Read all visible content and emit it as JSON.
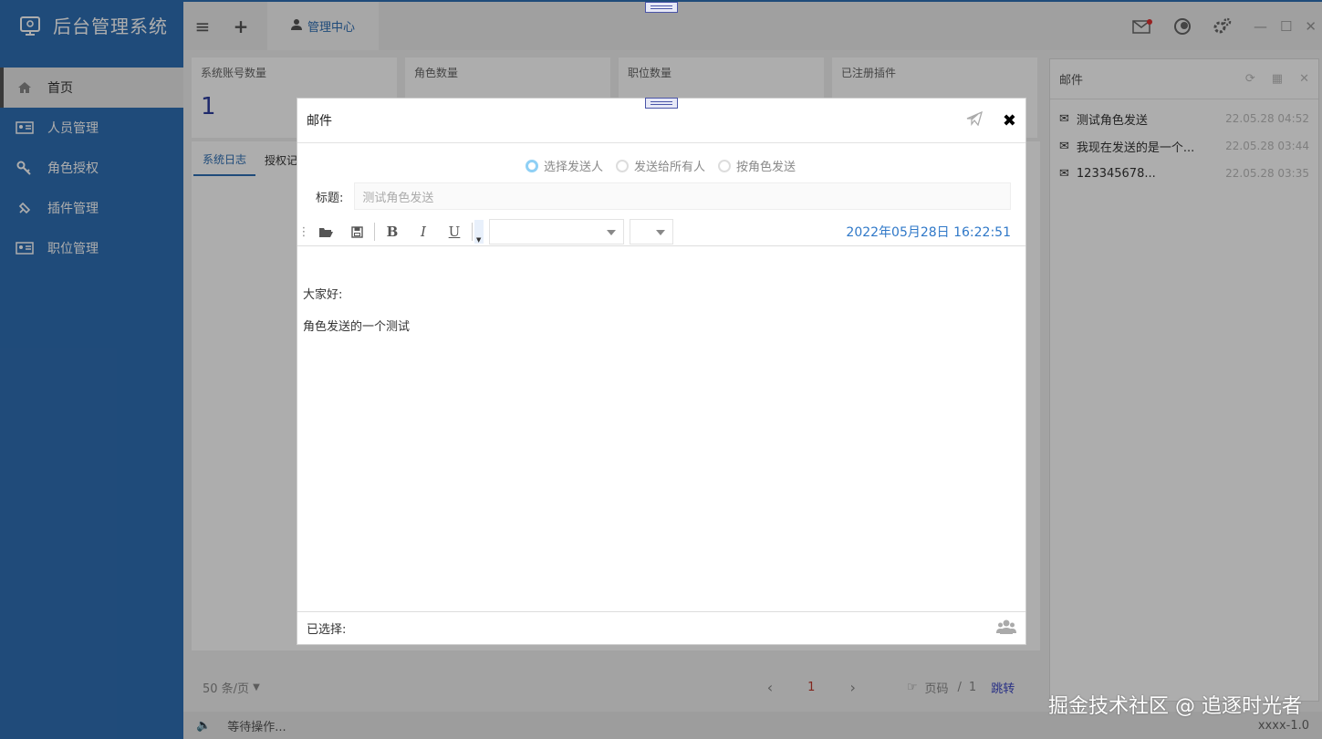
{
  "app": {
    "title": "后台管理系统",
    "version": "xxxx-1.0",
    "status": "等待操作..."
  },
  "sidebar": {
    "items": [
      {
        "label": "首页",
        "icon": "home-icon",
        "active": true
      },
      {
        "label": "人员管理",
        "icon": "id-card-icon"
      },
      {
        "label": "角色授权",
        "icon": "key-icon"
      },
      {
        "label": "插件管理",
        "icon": "plug-icon"
      },
      {
        "label": "职位管理",
        "icon": "id-card-icon"
      }
    ]
  },
  "topbar": {
    "tab_label": "管理中心"
  },
  "stats": [
    {
      "label": "系统账号数量",
      "value": "1"
    },
    {
      "label": "角色数量",
      "value": ""
    },
    {
      "label": "职位数量",
      "value": ""
    },
    {
      "label": "已注册插件",
      "value": ""
    }
  ],
  "subtabs": [
    "系统日志",
    "授权记"
  ],
  "pager": {
    "per_page": "50 条/页",
    "current": "1",
    "page_label": "页码",
    "total": "1",
    "jump": "跳转"
  },
  "mailpanel": {
    "title": "邮件",
    "items": [
      {
        "subject": "测试角色发送",
        "time": "22.05.28 04:52",
        "icon": "envelope-open-icon"
      },
      {
        "subject": "我现在发送的是一个...",
        "time": "22.05.28 03:44",
        "icon": "envelope-icon"
      },
      {
        "subject": "123345678...",
        "time": "22.05.28 03:35",
        "icon": "envelope-open-icon"
      }
    ]
  },
  "dialog": {
    "title": "邮件",
    "radios": [
      {
        "label": "选择发送人",
        "checked": true
      },
      {
        "label": "发送给所有人",
        "checked": false
      },
      {
        "label": "按角色发送",
        "checked": false
      }
    ],
    "subject_label": "标题:",
    "subject_value": "测试角色发送",
    "datetime": "2022年05月28日 16:22:51",
    "body_lines": [
      "大家好:",
      "角色发送的一个测试"
    ],
    "selected_label": "已选择:"
  },
  "watermark": "掘金技术社区 @ 追逐时光者",
  "colors": {
    "accent": "#2f6fb4",
    "datetime": "#2f78c8",
    "page_current": "#c0392b"
  }
}
